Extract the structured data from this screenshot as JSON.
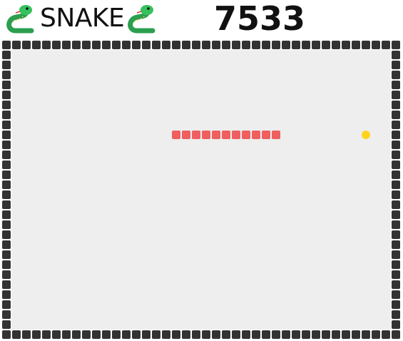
{
  "header": {
    "title": "SNAKE",
    "score": "7533",
    "icon": "snake-icon"
  },
  "game": {
    "cols": 40,
    "rows": 30,
    "snake": [
      [
        17,
        9
      ],
      [
        18,
        9
      ],
      [
        19,
        9
      ],
      [
        20,
        9
      ],
      [
        21,
        9
      ],
      [
        22,
        9
      ],
      [
        23,
        9
      ],
      [
        24,
        9
      ],
      [
        25,
        9
      ],
      [
        26,
        9
      ],
      [
        27,
        9
      ]
    ],
    "food": [
      36,
      9
    ],
    "colors": {
      "board": "#eeeeee",
      "wall": "#333333",
      "snake": "#ee5f5f",
      "food": "#ffd21f"
    }
  }
}
